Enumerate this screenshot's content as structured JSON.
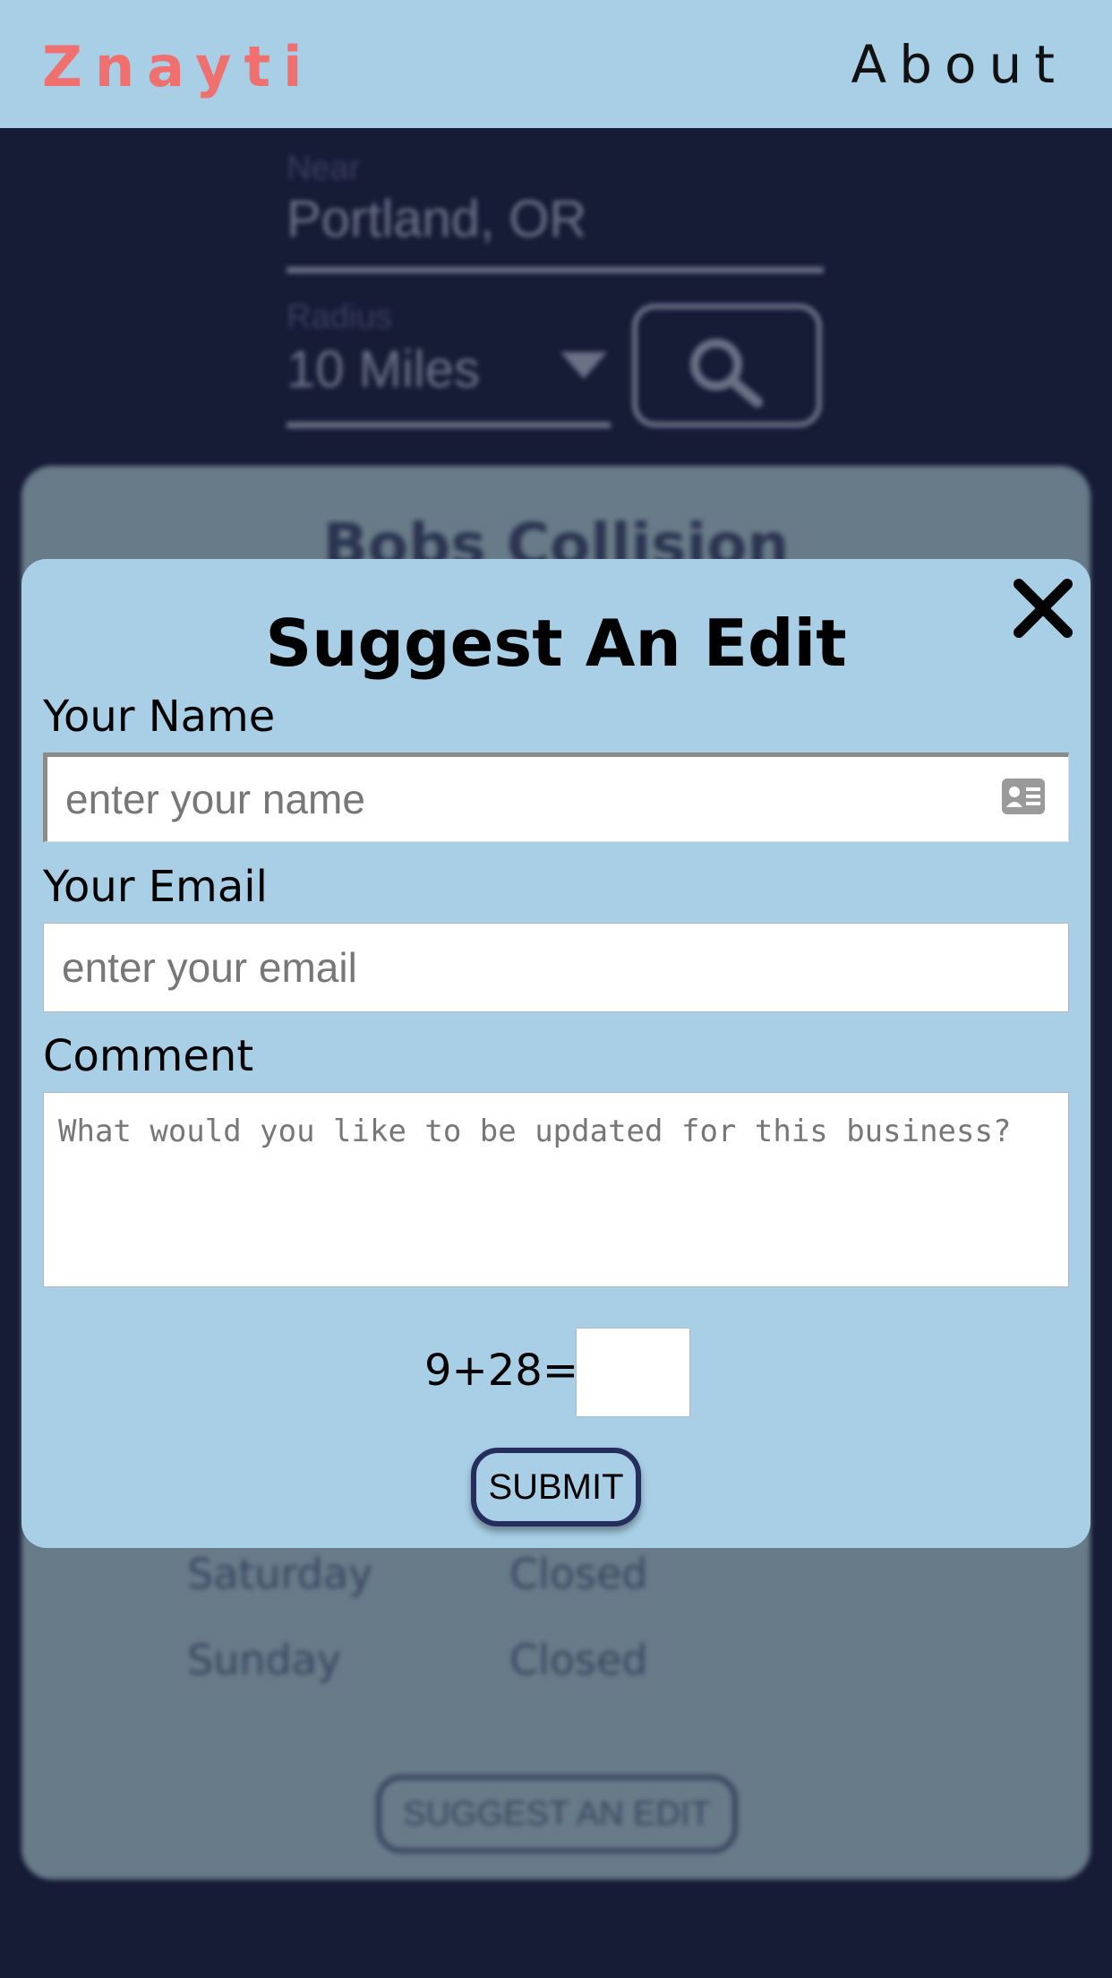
{
  "header": {
    "logo": "Znayti",
    "about_label": "About"
  },
  "search": {
    "near_label": "Near",
    "near_value": "Portland, OR",
    "radius_label": "Radius",
    "radius_value": "10 Miles",
    "search_icon": "search-icon"
  },
  "business_card": {
    "title": "Bobs Collision",
    "hours": [
      {
        "day": "Saturday",
        "time": "Closed"
      },
      {
        "day": "Sunday",
        "time": "Closed"
      }
    ],
    "suggest_edit_label": "SUGGEST AN EDIT"
  },
  "modal": {
    "title": "Suggest An Edit",
    "close_icon": "close-icon",
    "name_label": "Your Name",
    "name_placeholder": "enter your name",
    "name_value": "",
    "email_label": "Your Email",
    "email_placeholder": "enter your email",
    "email_value": "",
    "comment_label": "Comment",
    "comment_placeholder": "What would you like to be updated for this business?",
    "comment_value": "",
    "captcha_question": "9+28=",
    "captcha_value": "",
    "submit_label": "SUBMIT"
  },
  "colors": {
    "page_bg": "#161b36",
    "header_bg": "#a8cfe6",
    "logo": "#f07070",
    "modal_bg": "#a8cfe6",
    "button_border": "#252d5c"
  }
}
